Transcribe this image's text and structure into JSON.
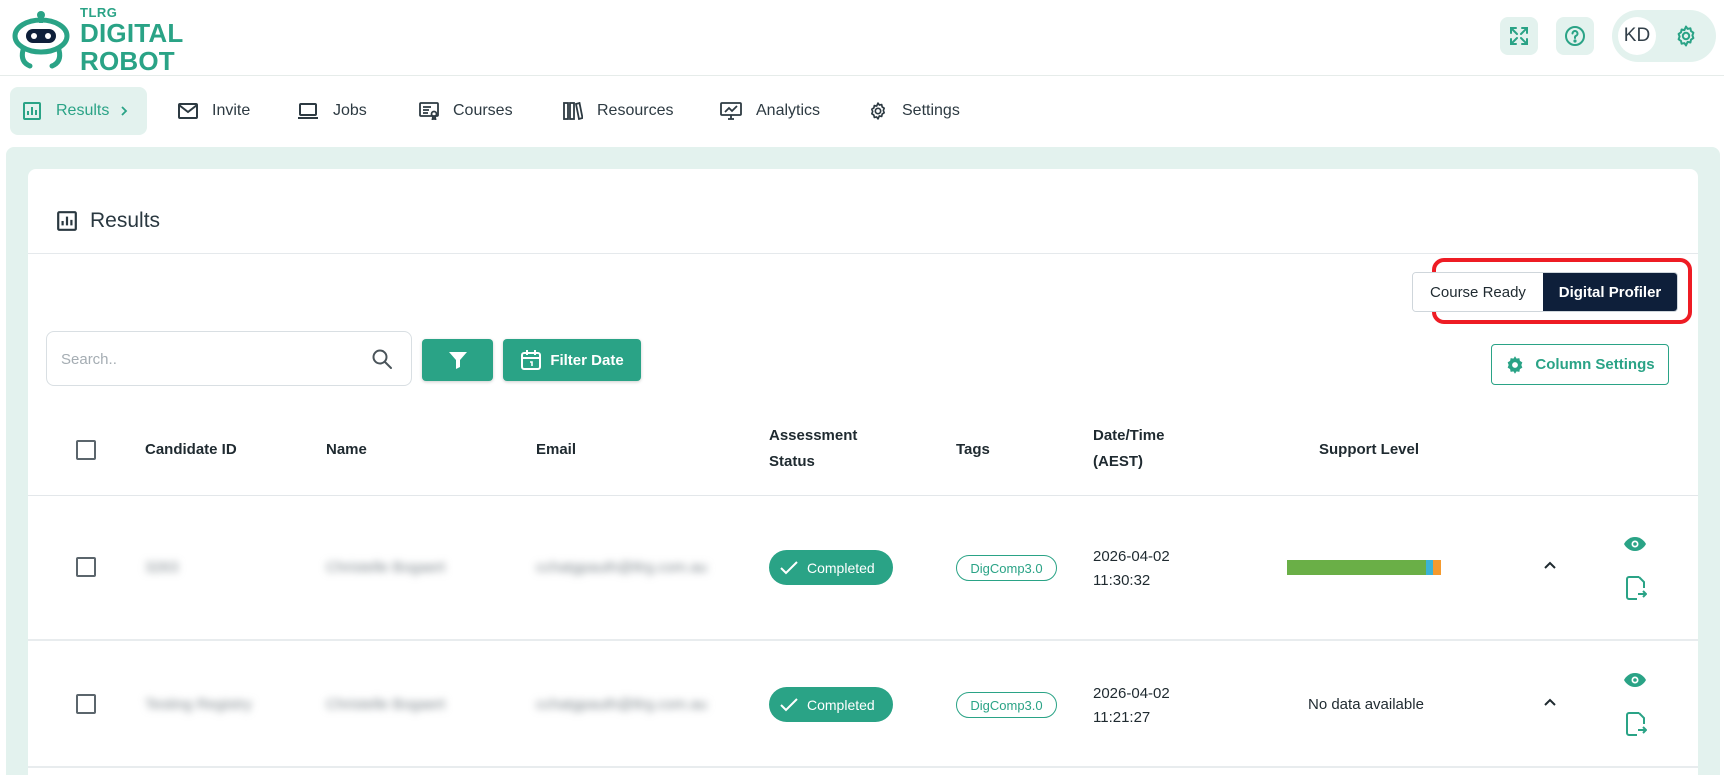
{
  "brand": {
    "small": "TLRG",
    "line1": "DIGITAL",
    "line2": "ROBOT",
    "color": "#2aa386"
  },
  "header": {
    "user_initials": "KD"
  },
  "nav": {
    "items": [
      {
        "label": "Results",
        "icon": "bar-chart-icon",
        "active": true
      },
      {
        "label": "Invite",
        "icon": "mail-icon"
      },
      {
        "label": "Jobs",
        "icon": "laptop-icon"
      },
      {
        "label": "Courses",
        "icon": "courses-icon"
      },
      {
        "label": "Resources",
        "icon": "books-icon"
      },
      {
        "label": "Analytics",
        "icon": "monitor-chart-icon"
      },
      {
        "label": "Settings",
        "icon": "gear-icon"
      }
    ]
  },
  "page": {
    "title": "Results"
  },
  "view_toggle": {
    "option_1": "Course Ready",
    "option_2": "Digital Profiler",
    "selected": "Digital Profiler"
  },
  "search": {
    "placeholder": "Search..",
    "value": ""
  },
  "toolbar": {
    "filter_date_label": "Filter Date",
    "column_settings_label": "Column Settings"
  },
  "table": {
    "columns": {
      "candidate_id": "Candidate ID",
      "name": "Name",
      "email": "Email",
      "assessment_status_1": "Assessment",
      "assessment_status_2": "Status",
      "tags": "Tags",
      "datetime_1": "Date/Time",
      "datetime_2": "(AEST)",
      "support_level": "Support Level"
    },
    "rows": [
      {
        "candidate_id": "3263",
        "name": "Christelle Bogaert",
        "email": "cchatgpauth@tlrg.com.au",
        "status": "Completed",
        "tag": "DigComp3.0",
        "date": "2026-04-02",
        "time": "11:30:32",
        "support_level": {
          "segments": [
            {
              "fraction": 0.9,
              "color": "#6aaf47"
            },
            {
              "fraction": 0.05,
              "color": "#3bb3d6"
            },
            {
              "fraction": 0.05,
              "color": "#f59a2e"
            }
          ]
        }
      },
      {
        "candidate_id": "Testing Registry",
        "name": "Christelle Bogaert",
        "email": "cchatgpauth@tlrg.com.au",
        "status": "Completed",
        "tag": "DigComp3.0",
        "date": "2026-04-02",
        "time": "11:21:27",
        "support_level_text": "No data available"
      }
    ]
  }
}
